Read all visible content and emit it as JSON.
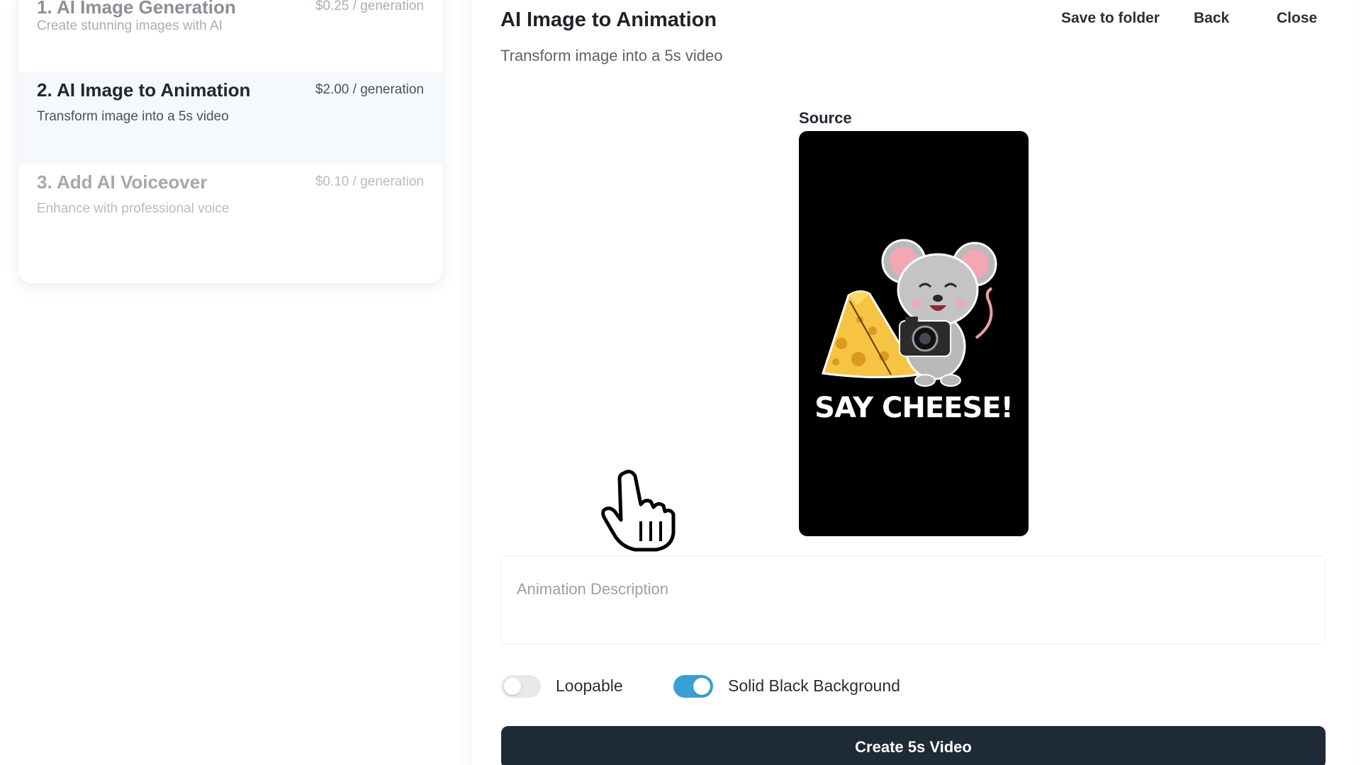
{
  "steps": [
    {
      "title": "1. AI Image Generation",
      "price": "$0.25 / generation",
      "desc": "Create stunning images with AI",
      "state": "inactive"
    },
    {
      "title": "2. AI Image to Animation",
      "price": "$2.00 / generation",
      "desc": "Transform image into a 5s video",
      "state": "active"
    },
    {
      "title": "3. Add AI Voiceover",
      "price": "$0.10 / generation",
      "desc": "Enhance with professional voice",
      "state": "disabled"
    }
  ],
  "panel": {
    "title": "AI Image to Animation",
    "subtitle": "Transform image into a 5s video",
    "save_label": "Save to folder",
    "back_label": "Back",
    "close_label": "Close"
  },
  "source": {
    "label": "Source",
    "image_caption": "SAY CHEESE!"
  },
  "description": {
    "placeholder": "Animation Description",
    "value": ""
  },
  "options": {
    "loopable_label": "Loopable",
    "loopable_on": false,
    "black_bg_label": "Solid Black Background",
    "black_bg_on": true
  },
  "create_label": "Create 5s Video",
  "colors": {
    "accent": "#3a9fd3",
    "button_bg": "#1f2a37",
    "active_step_bg": "#f5f9fd"
  },
  "icons": {
    "cursor": "hand-pointer-icon"
  }
}
